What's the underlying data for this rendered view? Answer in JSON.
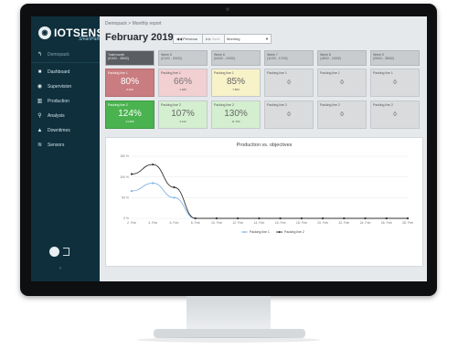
{
  "sidebar": {
    "logo_text": "IOTSENS",
    "logo_sub": "SmartPaths",
    "items": [
      {
        "label": "Demopack",
        "icon": "back-arrow-icon"
      },
      {
        "label": "Dashboard",
        "icon": "car-icon"
      },
      {
        "label": "Supervision",
        "icon": "eye-icon"
      },
      {
        "label": "Production",
        "icon": "bar-chart-icon"
      },
      {
        "label": "Analysis",
        "icon": "search-icon"
      },
      {
        "label": "Downtimes",
        "icon": "warning-icon"
      },
      {
        "label": "Sensors",
        "icon": "wifi-icon"
      }
    ]
  },
  "header": {
    "breadcrumb": "Demopack  >  Monthly report",
    "title": "February 2019",
    "prev_label": "◀◀ Previous",
    "next_label": "▶▶ Next",
    "shift_value": "Morning"
  },
  "grid": {
    "headers": [
      {
        "title": "Total month",
        "range": "(01/02 - 28/02)"
      },
      {
        "title": "Week 5",
        "range": "(01/02 - 03/02)"
      },
      {
        "title": "Week 6",
        "range": "(04/02 - 10/02)"
      },
      {
        "title": "Week 7",
        "range": "(11/02 - 17/02)"
      },
      {
        "title": "Week 8",
        "range": "(18/02 - 24/02)"
      },
      {
        "title": "Week 9",
        "range": "(25/02 - 28/02)"
      }
    ],
    "rows": [
      [
        {
          "line": "Packing line 1",
          "value": "80%",
          "sub": "8.640"
        },
        {
          "line": "Packing line 1",
          "value": "66%",
          "sub": "1.480"
        },
        {
          "line": "Packing line 1",
          "value": "85%",
          "sub": "7.800"
        },
        {
          "line": "Packing line 1",
          "value": "0",
          "sub": ""
        },
        {
          "line": "Packing line 1",
          "value": "0",
          "sub": ""
        },
        {
          "line": "Packing line 1",
          "value": "0",
          "sub": ""
        }
      ],
      [
        {
          "line": "Packing line 2",
          "value": "124%",
          "sub": "14.650"
        },
        {
          "line": "Packing line 2",
          "value": "107%",
          "sub": "3.210"
        },
        {
          "line": "Packing line 2",
          "value": "130%",
          "sub": "11.700"
        },
        {
          "line": "Packing line 2",
          "value": "0",
          "sub": ""
        },
        {
          "line": "Packing line 2",
          "value": "0",
          "sub": ""
        },
        {
          "line": "Packing line 2",
          "value": "0",
          "sub": ""
        }
      ]
    ]
  },
  "chart_data": {
    "type": "line",
    "title": "Production vs. objectives",
    "x": [
      "2. Feb",
      "4. Feb",
      "6. Feb",
      "8. Feb",
      "10. Feb",
      "12. Feb",
      "14. Feb",
      "16. Feb",
      "18. Feb",
      "20. Feb",
      "22. Feb",
      "24. Feb",
      "26. Feb",
      "28. Feb"
    ],
    "yticks": [
      "0 %",
      "50 %",
      "100 %",
      "150 %"
    ],
    "ylim": [
      0,
      150
    ],
    "series": [
      {
        "name": "Packing line 1",
        "color": "#7fb3e6",
        "values": [
          66,
          85,
          50,
          0,
          0,
          0,
          0,
          0,
          0,
          0,
          0,
          0,
          0,
          0
        ]
      },
      {
        "name": "Packing line 2",
        "color": "#333333",
        "values": [
          107,
          130,
          75,
          0,
          0,
          0,
          0,
          0,
          0,
          0,
          0,
          0,
          0,
          0
        ]
      }
    ],
    "legend_position": "bottom-center"
  }
}
